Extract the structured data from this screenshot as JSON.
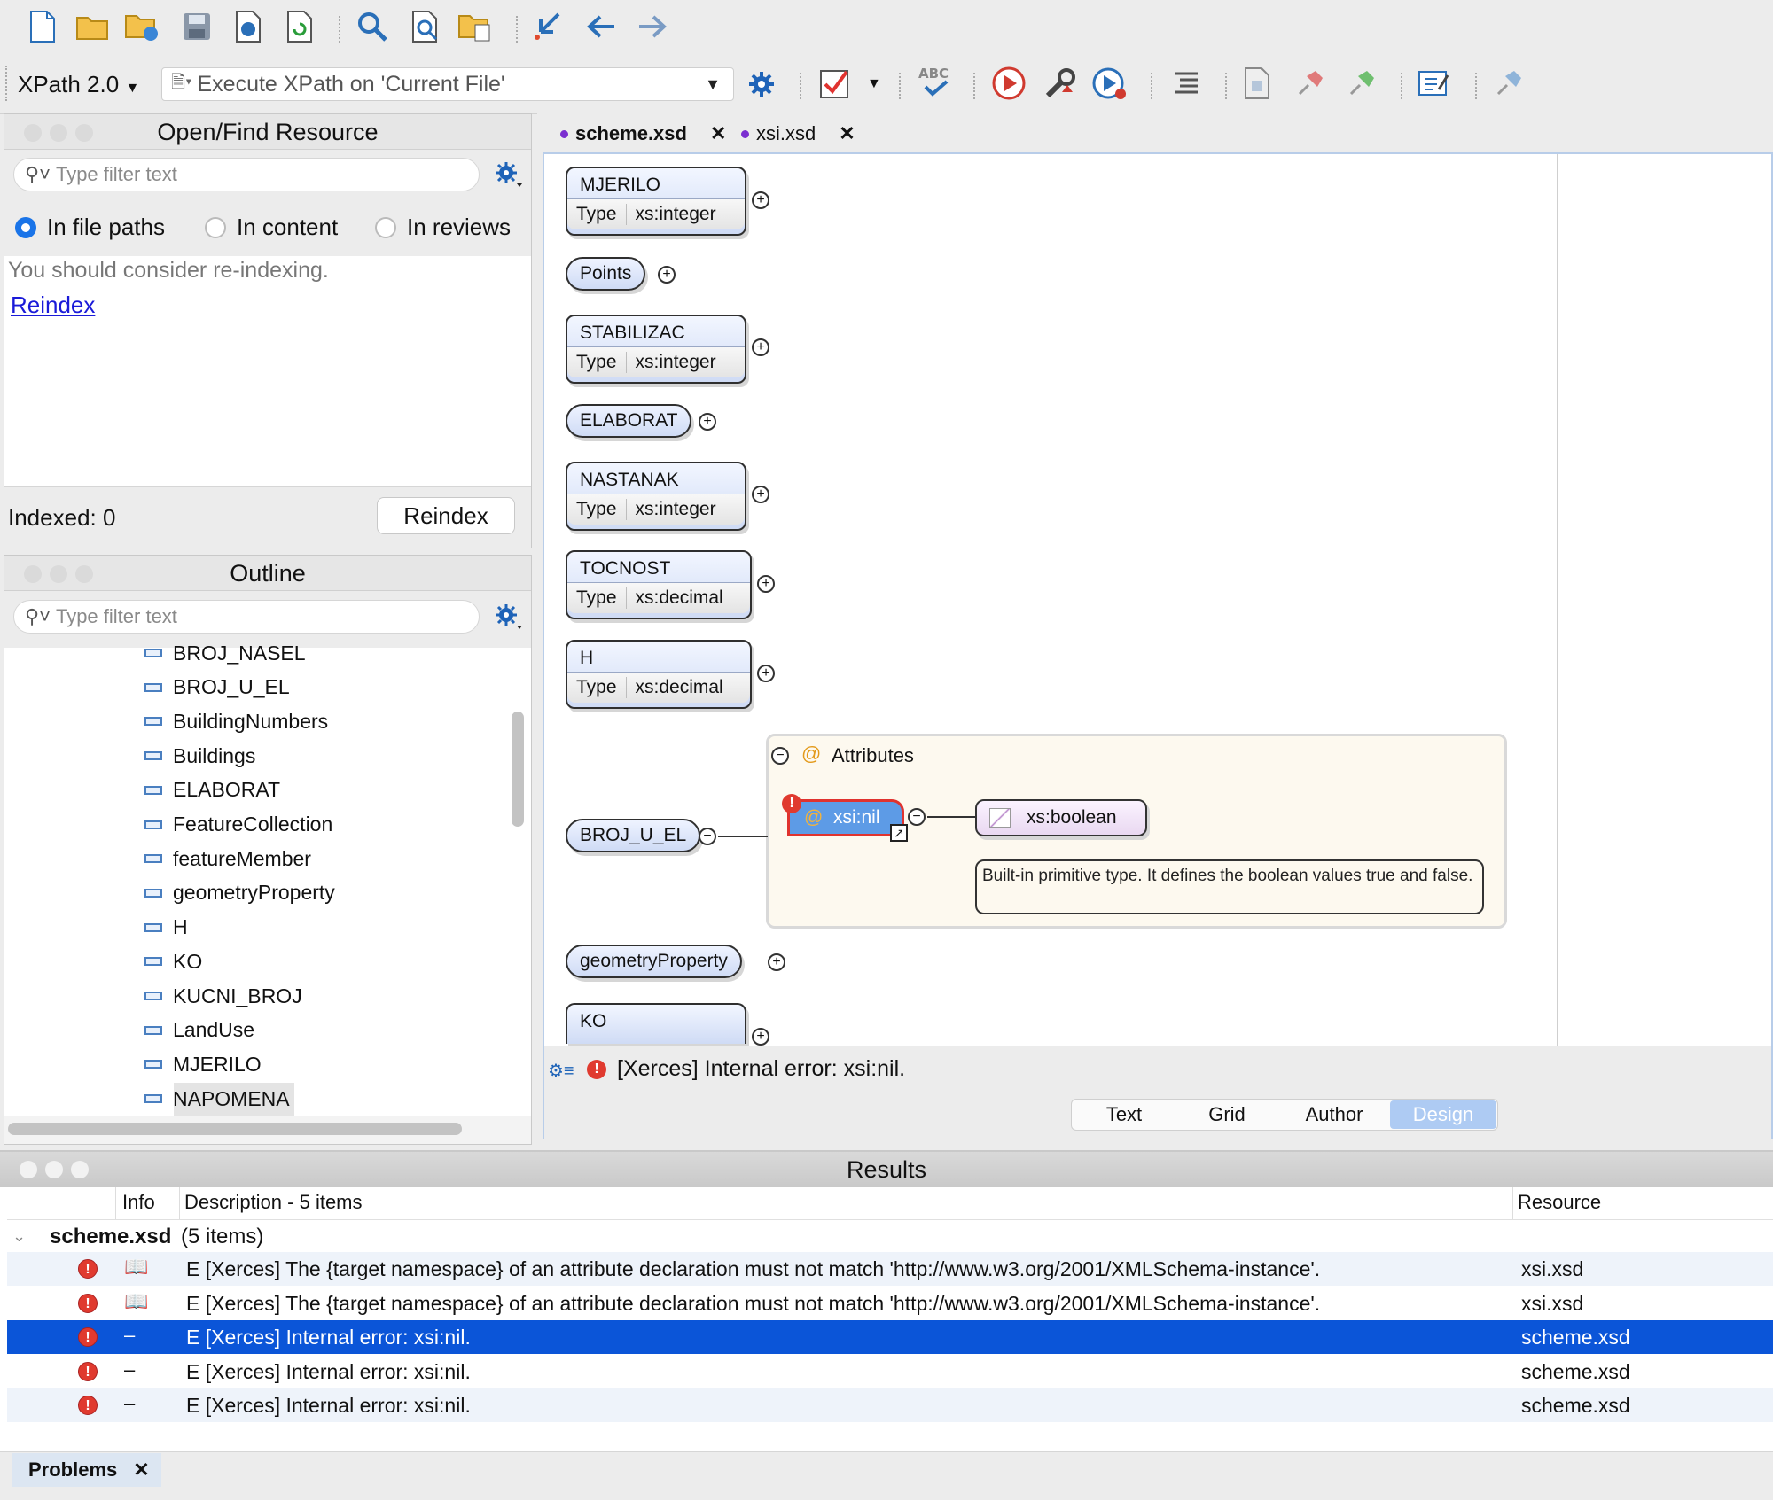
{
  "toolbar": {
    "xpath_version": "XPath 2.0",
    "xpath_placeholder": "Execute XPath on  'Current File'"
  },
  "open_find": {
    "title": "Open/Find Resource",
    "filter_placeholder": "Type filter text",
    "radio_options": [
      "In file paths",
      "In content",
      "In reviews"
    ],
    "message": "You should consider re-indexing.",
    "reindex_link": "Reindex",
    "indexed_label": "Indexed: 0",
    "reindex_button": "Reindex"
  },
  "outline": {
    "title": "Outline",
    "filter_placeholder": "Type filter text",
    "items": [
      "BROJ_NASEL",
      "BROJ_U_EL",
      "BuildingNumbers",
      "Buildings",
      "ELABORAT",
      "FeatureCollection",
      "featureMember",
      "geometryProperty",
      "H",
      "KO",
      "KUCNI_BROJ",
      "LandUse",
      "MJERILO",
      "NAPOMENA"
    ]
  },
  "editor": {
    "tabs": [
      "scheme.xsd",
      "xsi.xsd"
    ],
    "type_key": "Type",
    "nodes": {
      "mjerilo": {
        "name": "MJERILO",
        "type": "xs:integer"
      },
      "points": {
        "name": "Points"
      },
      "stabilizac": {
        "name": "STABILIZAC",
        "type": "xs:integer"
      },
      "elaborat": {
        "name": "ELABORAT"
      },
      "nastanak": {
        "name": "NASTANAK",
        "type": "xs:integer"
      },
      "tocnost": {
        "name": "TOCNOST",
        "type": "xs:decimal"
      },
      "h": {
        "name": "H",
        "type": "xs:decimal"
      },
      "broj_u_el": {
        "name": "BROJ_U_EL"
      },
      "geometry": {
        "name": "geometryProperty"
      },
      "ko": {
        "name": "KO"
      }
    },
    "attributes_label": "Attributes",
    "xsi_nil": "xsi:nil",
    "xs_boolean": "xs:boolean",
    "tooltip": "Built-in primitive type. It defines the boolean values true and false.",
    "status_error": "[Xerces] Internal error: xsi:nil.",
    "view_tabs": [
      "Text",
      "Grid",
      "Author",
      "Design"
    ]
  },
  "results": {
    "title": "Results",
    "col_info": "Info",
    "col_description": "Description - 5 items",
    "col_resource": "Resource",
    "group_file": "scheme.xsd",
    "group_count": "(5 items)",
    "rows": [
      {
        "info": "📖",
        "desc": "E [Xerces] The {target namespace} of an attribute declaration must not match 'http://www.w3.org/2001/XMLSchema-instance'.",
        "resource": "xsi.xsd"
      },
      {
        "info": "📖",
        "desc": "E [Xerces] The {target namespace} of an attribute declaration must not match 'http://www.w3.org/2001/XMLSchema-instance'.",
        "resource": "xsi.xsd"
      },
      {
        "info": "–",
        "desc": "E [Xerces] Internal error: xsi:nil.",
        "resource": "scheme.xsd"
      },
      {
        "info": "–",
        "desc": "E [Xerces] Internal error: xsi:nil.",
        "resource": "scheme.xsd"
      },
      {
        "info": "–",
        "desc": "E [Xerces] Internal error: xsi:nil.",
        "resource": "scheme.xsd"
      }
    ],
    "bottom_tab": "Problems"
  },
  "colors": {
    "accent": "#1a74e8",
    "selection": "#0b55d8",
    "error": "#e03a2f"
  }
}
